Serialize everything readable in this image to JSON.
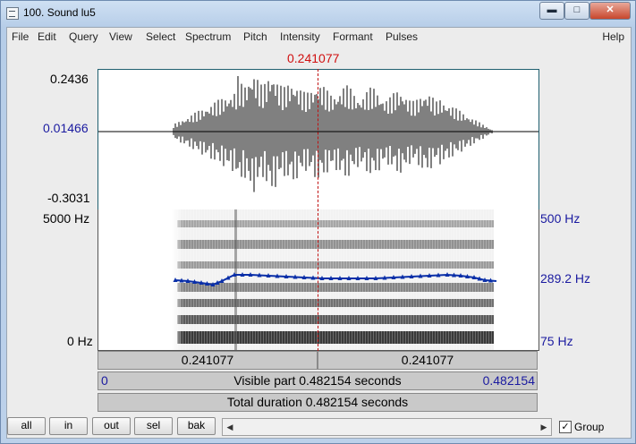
{
  "window": {
    "title": "100. Sound lu5",
    "minimize_glyph": "▬",
    "maximize_glyph": "□",
    "close_glyph": "✕"
  },
  "menu": {
    "items": [
      "File",
      "Edit",
      "Query",
      "View",
      "Select",
      "Spectrum",
      "Pitch",
      "Intensity",
      "Formant",
      "Pulses"
    ],
    "help": "Help"
  },
  "cursor": {
    "time": "0.241077"
  },
  "waveform": {
    "max": "0.2436",
    "value": "0.01466",
    "min": "-0.3031"
  },
  "spectrogram": {
    "freq_top": "5000 Hz",
    "freq_bottom": "0 Hz",
    "pitch_top": "500 Hz",
    "pitch_value": "289.2 Hz",
    "pitch_bottom": "75 Hz"
  },
  "time_bars": {
    "left_part": "0.241077",
    "right_part": "0.241077",
    "visible_start": "0",
    "visible_label": "Visible part 0.482154 seconds",
    "visible_end": "0.482154",
    "total_label": "Total duration 0.482154 seconds"
  },
  "buttons": {
    "all": "all",
    "in": "in",
    "out": "out",
    "sel": "sel",
    "bak": "bak"
  },
  "group": {
    "label": "Group",
    "checked": "✓"
  },
  "colors": {
    "cursor": "#d01010",
    "pitch_line": "#0a2fa8",
    "blue_label": "#1a1aa0"
  }
}
